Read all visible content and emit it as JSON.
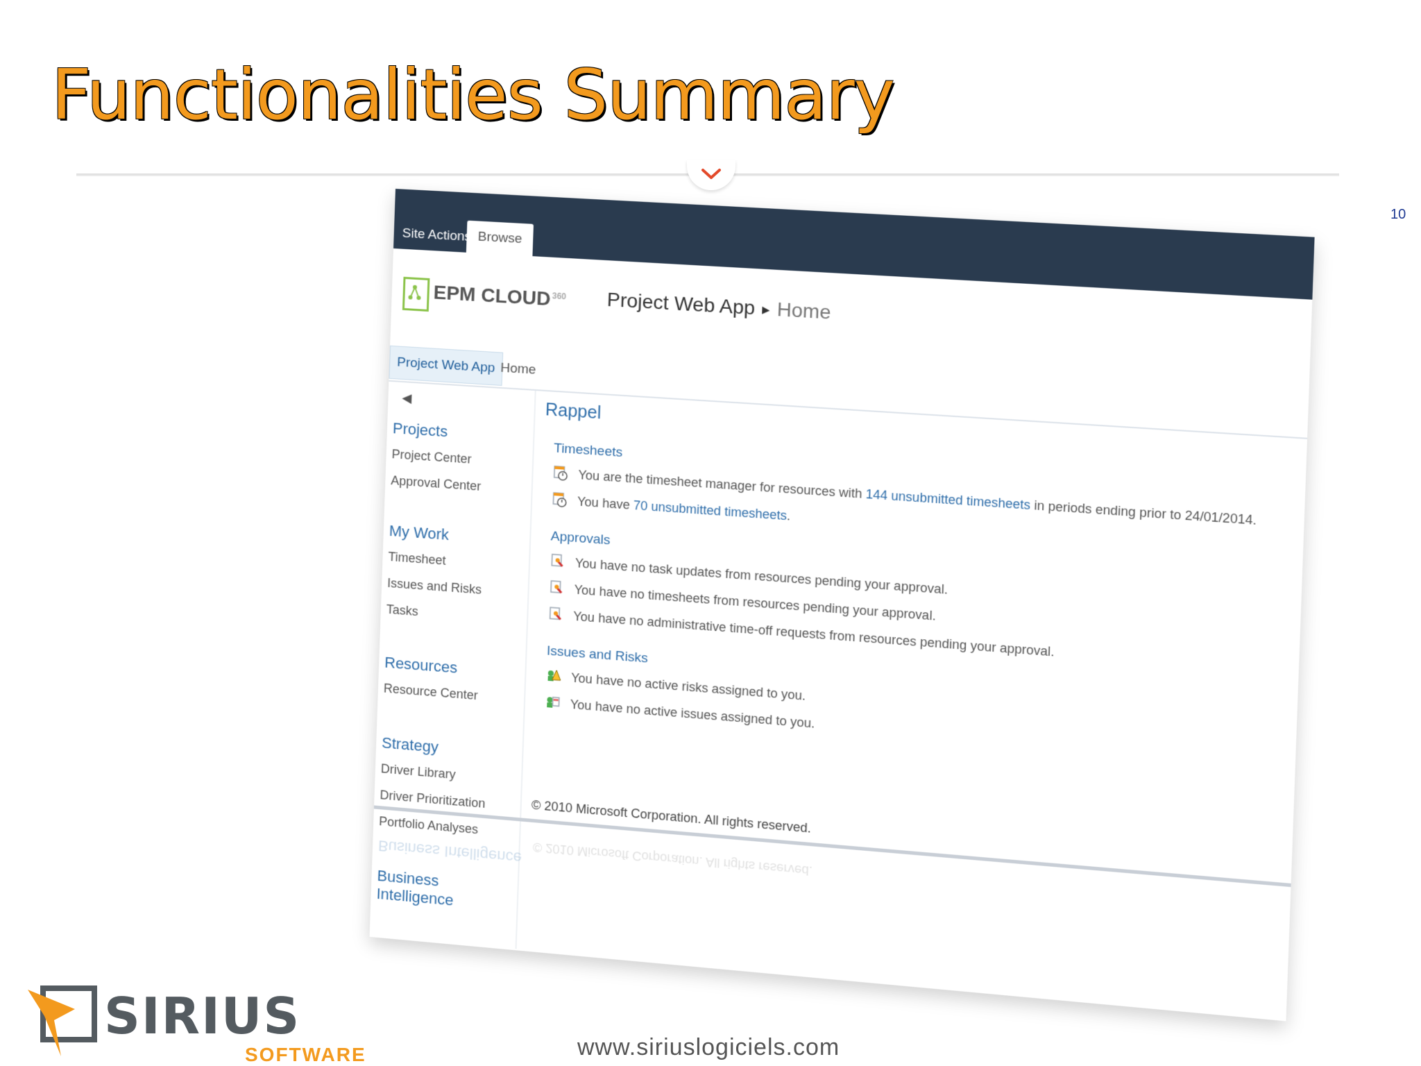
{
  "slide": {
    "title": "Functionalities Summary",
    "page_number": "10",
    "brand": {
      "name": "SIRIUS",
      "sub": "SOFTWARE"
    },
    "website": "www.siriuslogiciels.com"
  },
  "app": {
    "ribbon": {
      "site_actions": "Site Actions",
      "browse": "Browse"
    },
    "logo": {
      "text": "EPM CLOUD",
      "sup": "360"
    },
    "breadcrumb": {
      "site": "Project Web App",
      "page": "Home"
    },
    "topnav": {
      "tab1": "Project Web App",
      "tab2": "Home"
    },
    "leftnav": {
      "projects": "Projects",
      "project_center": "Project Center",
      "approval_center": "Approval Center",
      "my_work": "My Work",
      "timesheet": "Timesheet",
      "issues_risks": "Issues and Risks",
      "tasks": "Tasks",
      "resources": "Resources",
      "resource_center": "Resource Center",
      "strategy": "Strategy",
      "driver_library": "Driver Library",
      "driver_prioritization": "Driver Prioritization",
      "portfolio_analyses": "Portfolio Analyses",
      "business_intelligence": "Business Intelligence"
    },
    "content": {
      "heading": "Rappel",
      "timesheets": {
        "title": "Timesheets",
        "r1_pre": "You are the timesheet manager for resources with ",
        "r1_link": "144 unsubmitted timesheets",
        "r1_post": " in periods ending prior to 24/01/2014.",
        "r2_pre": "You have ",
        "r2_link": "70 unsubmitted timesheets",
        "r2_post": "."
      },
      "approvals": {
        "title": "Approvals",
        "r1": "You have no task updates from resources pending your approval.",
        "r2": "You have no timesheets from resources pending your approval.",
        "r3": "You have no administrative time-off requests from resources pending your approval."
      },
      "issues": {
        "title": "Issues and Risks",
        "r1": "You have no active risks assigned to you.",
        "r2": "You have no active issues assigned to you."
      }
    },
    "footer": "© 2010 Microsoft Corporation. All rights reserved.",
    "colors": {
      "header_bar": "#2a3b4f",
      "link": "#2f6eaa",
      "accent": "#f39a1e"
    }
  }
}
